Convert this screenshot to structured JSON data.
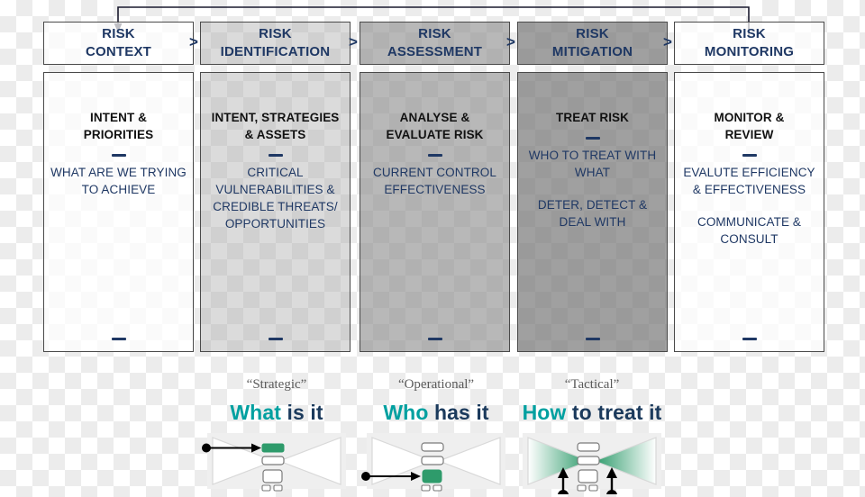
{
  "diagram": {
    "title_colors": {
      "header_text": "#1F3864",
      "body_heading": "#111111",
      "body_text": "#1F3864",
      "teal": "#00A0A0",
      "navy": "#1B3A5C",
      "green": "#2E9B6B",
      "border": "#4A4A4A"
    },
    "chevron": ">",
    "columns": [
      {
        "header_line1": "RISK",
        "header_line2": "CONTEXT",
        "body_heading_line1": "INTENT &",
        "body_heading_line2": "PRIORITIES",
        "paragraphs": [
          "WHAT ARE WE TRYING TO ACHIEVE"
        ]
      },
      {
        "header_line1": "RISK",
        "header_line2": "IDENTIFICATION",
        "body_heading_line1": "INTENT, STRATEGIES",
        "body_heading_line2": "& ASSETS",
        "paragraphs": [
          "CRITICAL VULNERABILITIES & CREDIBLE THREATS/ OPPORTUNITIES"
        ]
      },
      {
        "header_line1": "RISK",
        "header_line2": "ASSESSMENT",
        "body_heading_line1": "ANALYSE &",
        "body_heading_line2": "EVALUATE RISK",
        "paragraphs": [
          "CURRENT CONTROL EFFECTIVENESS"
        ]
      },
      {
        "header_line1": "RISK",
        "header_line2": "MITIGATION",
        "body_heading_line1": "TREAT RISK",
        "body_heading_line2": "",
        "paragraphs": [
          "WHO TO TREAT WITH WHAT",
          "DETER, DETECT & DEAL WITH"
        ]
      },
      {
        "header_line1": "RISK",
        "header_line2": "MONITORING",
        "body_heading_line1": "MONITOR &",
        "body_heading_line2": "REVIEW",
        "paragraphs": [
          "EVALUTE EFFICIENCY & EFFECTIVENESS",
          "COMMUNICATE & CONSULT"
        ]
      }
    ],
    "bottom": [
      {
        "quote": "“Strategic”",
        "phrase_accent": "What",
        "phrase_rest": " is it"
      },
      {
        "quote": "“Operational”",
        "phrase_accent": "Who",
        "phrase_rest": " has it"
      },
      {
        "quote": "“Tactical”",
        "phrase_accent": "How",
        "phrase_rest": " to treat it"
      }
    ]
  }
}
